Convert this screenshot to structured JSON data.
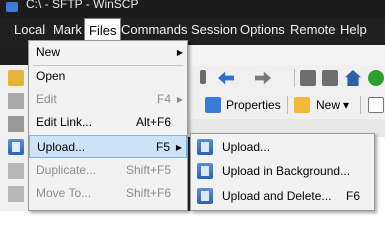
{
  "window": {
    "title": "C:\\ - SFTP - WinSCP"
  },
  "menubar": {
    "items": [
      "Local",
      "Mark",
      "Files",
      "Commands",
      "Session",
      "Options",
      "Remote",
      "Help"
    ],
    "active": "Files"
  },
  "toolbar": {
    "properties_label": "Properties",
    "new_label": "New",
    "new_dropdown": "▾"
  },
  "files_menu": {
    "items": [
      {
        "label": "New",
        "shortcut": "",
        "submenu": true,
        "disabled": false
      },
      {
        "label": "Open",
        "shortcut": "",
        "submenu": false,
        "disabled": false
      },
      {
        "label": "Edit",
        "shortcut": "F4",
        "submenu": true,
        "disabled": true
      },
      {
        "label": "Edit Link...",
        "shortcut": "Alt+F6",
        "submenu": false,
        "disabled": false
      },
      {
        "label": "Upload...",
        "shortcut": "F5",
        "submenu": true,
        "disabled": false,
        "highlighted": true
      },
      {
        "label": "Duplicate...",
        "shortcut": "Shift+F5",
        "submenu": false,
        "disabled": true
      },
      {
        "label": "Move To...",
        "shortcut": "Shift+F6",
        "submenu": false,
        "disabled": true
      }
    ]
  },
  "upload_submenu": {
    "items": [
      {
        "label": "Upload...",
        "shortcut": ""
      },
      {
        "label": "Upload in Background...",
        "shortcut": ""
      },
      {
        "label": "Upload and Delete...",
        "shortcut": "F6"
      }
    ]
  },
  "glyphs": {
    "submenu_arrow": "▶"
  },
  "colors": {
    "menubar_bg": "#202020",
    "highlight_bg": "#cde3f7",
    "highlight_border": "#7fb2e0",
    "disabled_text": "#8c8c8c"
  }
}
